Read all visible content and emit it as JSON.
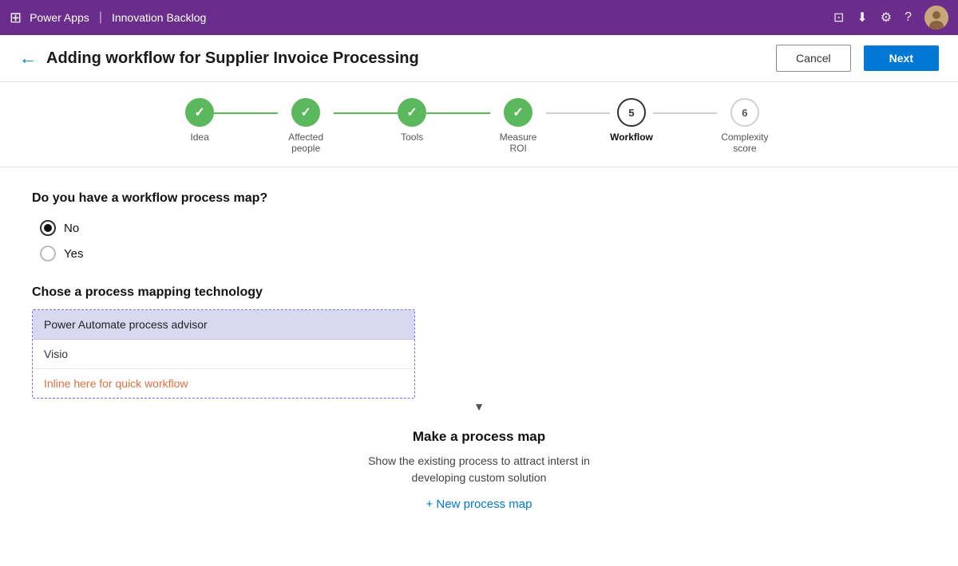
{
  "topbar": {
    "app_name": "Power Apps",
    "separator": "|",
    "section_name": "Innovation Backlog"
  },
  "header": {
    "title": "Adding workflow for Supplier Invoice Processing",
    "cancel_label": "Cancel",
    "next_label": "Next"
  },
  "stepper": {
    "steps": [
      {
        "id": 1,
        "label": "Idea",
        "state": "completed",
        "number": "✓"
      },
      {
        "id": 2,
        "label": "Affected people",
        "state": "completed",
        "number": "✓"
      },
      {
        "id": 3,
        "label": "Tools",
        "state": "completed",
        "number": "✓"
      },
      {
        "id": 4,
        "label": "Measure ROI",
        "state": "completed",
        "number": "✓"
      },
      {
        "id": 5,
        "label": "Workflow",
        "state": "active",
        "number": "5"
      },
      {
        "id": 6,
        "label": "Complexity score",
        "state": "pending",
        "number": "6"
      }
    ]
  },
  "workflow_question": {
    "label": "Do you have a workflow process map?",
    "options": [
      {
        "value": "no",
        "label": "No",
        "selected": true
      },
      {
        "value": "yes",
        "label": "Yes",
        "selected": false
      }
    ]
  },
  "process_mapping": {
    "label": "Chose a process mapping technology",
    "options": [
      {
        "value": "power_automate",
        "label": "Power Automate process advisor",
        "selected": true
      },
      {
        "value": "visio",
        "label": "Visio",
        "selected": false
      },
      {
        "value": "inline",
        "label": "Inline here for quick workflow",
        "selected": false
      }
    ]
  },
  "process_map_section": {
    "title": "Make a process map",
    "description": "Show the existing process to attract interst in\ndeveloping custom solution",
    "new_button_label": "+ New process map"
  }
}
